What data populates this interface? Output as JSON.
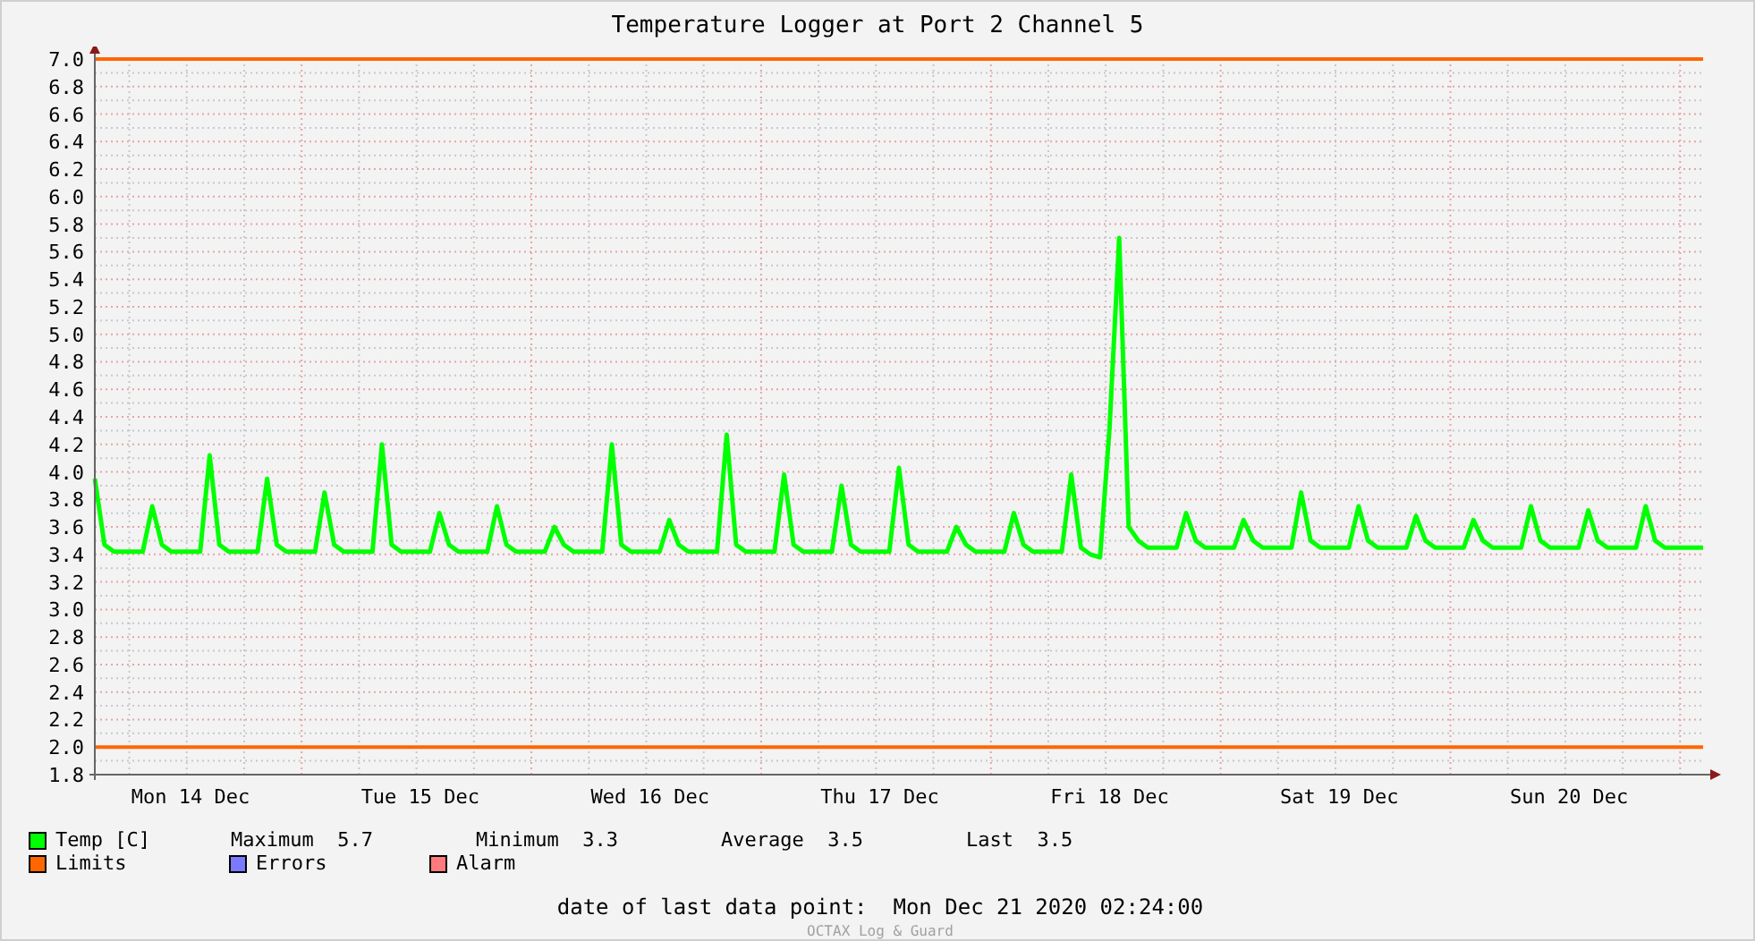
{
  "chart_data": {
    "type": "line",
    "title": "Temperature Logger at Port 2 Channel 5",
    "ylim": [
      1.8,
      7.0
    ],
    "yticks": [
      {
        "value": 1.8,
        "label": "1.8"
      },
      {
        "value": 2,
        "label": "2.0"
      },
      {
        "value": 2.2,
        "label": "2.2"
      },
      {
        "value": 2.4,
        "label": "2.4"
      },
      {
        "value": 2.6,
        "label": "2.6"
      },
      {
        "value": 2.8,
        "label": "2.8"
      },
      {
        "value": 3,
        "label": "3.0"
      },
      {
        "value": 3.2,
        "label": "3.2"
      },
      {
        "value": 3.4,
        "label": "3.4"
      },
      {
        "value": 3.6,
        "label": "3.6"
      },
      {
        "value": 3.8,
        "label": "3.8"
      },
      {
        "value": 4,
        "label": "4.0"
      },
      {
        "value": 4.2,
        "label": "4.2"
      },
      {
        "value": 4.4,
        "label": "4.4"
      },
      {
        "value": 4.6,
        "label": "4.6"
      },
      {
        "value": 4.8,
        "label": "4.8"
      },
      {
        "value": 5,
        "label": "5.0"
      },
      {
        "value": 5.2,
        "label": "5.2"
      },
      {
        "value": 5.4,
        "label": "5.4"
      },
      {
        "value": 5.6,
        "label": "5.6"
      },
      {
        "value": 5.8,
        "label": "5.8"
      },
      {
        "value": 6,
        "label": "6.0"
      },
      {
        "value": 6.2,
        "label": "6.2"
      },
      {
        "value": 6.4,
        "label": "6.4"
      },
      {
        "value": 6.6,
        "label": "6.6"
      },
      {
        "value": 6.8,
        "label": "6.8"
      },
      {
        "value": 7,
        "label": "7.0"
      }
    ],
    "categories": [
      null,
      null,
      null,
      null,
      null,
      null,
      null,
      null,
      null,
      null,
      "Mon 14 Dec",
      null,
      null,
      null,
      null,
      null,
      null,
      null,
      null,
      null,
      null,
      null,
      null,
      null,
      null,
      null,
      null,
      null,
      null,
      null,
      null,
      null,
      null,
      null,
      "Tue 15 Dec",
      null,
      null,
      null,
      null,
      null,
      null,
      null,
      null,
      null,
      null,
      null,
      null,
      null,
      null,
      null,
      null,
      null,
      null,
      null,
      null,
      null,
      null,
      null,
      "Wed 16 Dec",
      null,
      null,
      null,
      null,
      null,
      null,
      null,
      null,
      null,
      null,
      null,
      null,
      null,
      null,
      null,
      null,
      null,
      null,
      null,
      null,
      null,
      null,
      null,
      "Thu 17 Dec",
      null,
      null,
      null,
      null,
      null,
      null,
      null,
      null,
      null,
      null,
      null,
      null,
      null,
      null,
      null,
      null,
      null,
      null,
      null,
      null,
      null,
      null,
      null,
      "Fri 18 Dec",
      null,
      null,
      null,
      null,
      null,
      null,
      null,
      null,
      null,
      null,
      null,
      null,
      null,
      null,
      null,
      null,
      null,
      null,
      null,
      null,
      null,
      null,
      null,
      "Sat 19 Dec",
      null,
      null,
      null,
      null,
      null,
      null,
      null,
      null,
      null,
      null,
      null,
      null,
      null,
      null,
      null,
      null,
      null,
      null,
      null,
      null,
      null,
      null,
      null,
      "Sun 20 Dec",
      null,
      null,
      null,
      null,
      null,
      null,
      null,
      null,
      null,
      null,
      null,
      null,
      null,
      null
    ],
    "series": [
      {
        "name": "Temp [C]",
        "color": "#00ff00",
        "values": [
          3.95,
          3.47,
          3.42,
          3.42,
          3.42,
          3.42,
          3.75,
          3.47,
          3.42,
          3.42,
          3.42,
          3.42,
          4.12,
          3.47,
          3.42,
          3.42,
          3.42,
          3.42,
          3.95,
          3.47,
          3.42,
          3.42,
          3.42,
          3.42,
          3.85,
          3.47,
          3.42,
          3.42,
          3.42,
          3.42,
          4.2,
          3.47,
          3.42,
          3.42,
          3.42,
          3.42,
          3.7,
          3.47,
          3.42,
          3.42,
          3.42,
          3.42,
          3.75,
          3.47,
          3.42,
          3.42,
          3.42,
          3.42,
          3.6,
          3.47,
          3.42,
          3.42,
          3.42,
          3.42,
          4.2,
          3.47,
          3.42,
          3.42,
          3.42,
          3.42,
          3.65,
          3.47,
          3.42,
          3.42,
          3.42,
          3.42,
          4.27,
          3.47,
          3.42,
          3.42,
          3.42,
          3.42,
          3.98,
          3.47,
          3.42,
          3.42,
          3.42,
          3.42,
          3.9,
          3.47,
          3.42,
          3.42,
          3.42,
          3.42,
          4.03,
          3.47,
          3.42,
          3.42,
          3.42,
          3.42,
          3.6,
          3.47,
          3.42,
          3.42,
          3.42,
          3.42,
          3.7,
          3.47,
          3.42,
          3.42,
          3.42,
          3.42,
          3.98,
          3.45,
          3.4,
          3.38,
          4.32,
          5.7,
          3.6,
          3.5,
          3.45,
          3.45,
          3.45,
          3.45,
          3.7,
          3.5,
          3.45,
          3.45,
          3.45,
          3.45,
          3.65,
          3.5,
          3.45,
          3.45,
          3.45,
          3.45,
          3.85,
          3.5,
          3.45,
          3.45,
          3.45,
          3.45,
          3.75,
          3.5,
          3.45,
          3.45,
          3.45,
          3.45,
          3.68,
          3.5,
          3.45,
          3.45,
          3.45,
          3.45,
          3.65,
          3.5,
          3.45,
          3.45,
          3.45,
          3.45,
          3.75,
          3.5,
          3.45,
          3.45,
          3.45,
          3.45,
          3.72,
          3.5,
          3.45,
          3.45,
          3.45,
          3.45,
          3.75,
          3.5,
          3.45,
          3.45,
          3.45,
          3.45,
          3.45
        ]
      }
    ],
    "grid": true,
    "ref_lines": [
      {
        "axis": "y",
        "value": 7.0,
        "color": "#ff6600"
      },
      {
        "axis": "y",
        "value": 2.0,
        "color": "#ff6600"
      }
    ]
  },
  "legend": [
    {
      "label": "Limits",
      "color": "#ff6600"
    },
    {
      "label": "Errors",
      "color": "#7a7aff"
    },
    {
      "label": "Alarm",
      "color": "#ff7a7a"
    }
  ],
  "stats": [
    {
      "label": "Maximum",
      "value": "5.7"
    },
    {
      "label": "Minimum",
      "value": "3.3"
    },
    {
      "label": "Average",
      "value": "3.5"
    },
    {
      "label": "Last",
      "value": "3.5"
    }
  ],
  "footer": {
    "label": "date of last data point:",
    "value": "Mon Dec 21 2020 02:24:00"
  },
  "credit": "OCTAX Log & Guard"
}
